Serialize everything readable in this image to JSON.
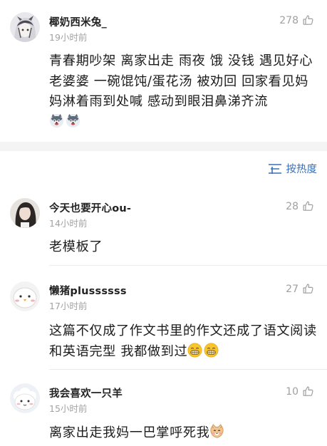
{
  "comments": [
    {
      "username": "椰奶西米兔_",
      "time": "19小时前",
      "likes": "278",
      "text": "青春期吵架 离家出走 雨夜 饿 没钱 遇见好心老婆婆 一碗馄饨/蛋花汤 被劝回 回家看见妈妈淋着雨到处喊 感动到眼泪鼻涕齐流",
      "emojis": [
        "husky-dog-emoji",
        "husky-dog-emoji"
      ]
    },
    {
      "username": "今天也要开心ou-",
      "time": "14小时前",
      "likes": "28",
      "text": "老模板了"
    },
    {
      "username": "懒猪plussssss",
      "time": "17小时前",
      "likes": "27",
      "text": "这篇不仅成了作文书里的作文还成了语文阅读和英语完型 我都做到过",
      "emojis": [
        "grinning-face-emoji",
        "grinning-face-emoji"
      ]
    },
    {
      "username": "我会喜欢一只羊",
      "time": "15小时前",
      "likes": "10",
      "text": "离家出走我妈一巴掌呼死我",
      "emojis": [
        "cat-face-emoji"
      ]
    }
  ],
  "sort": {
    "label": "按热度",
    "icon": "sort-icon"
  },
  "icons": {
    "like": "thumbs-up-icon"
  },
  "colors": {
    "accent": "#3b6fb8",
    "muted": "#a3a3a3",
    "divider": "#ececec",
    "gap": "#f4f4f4"
  }
}
